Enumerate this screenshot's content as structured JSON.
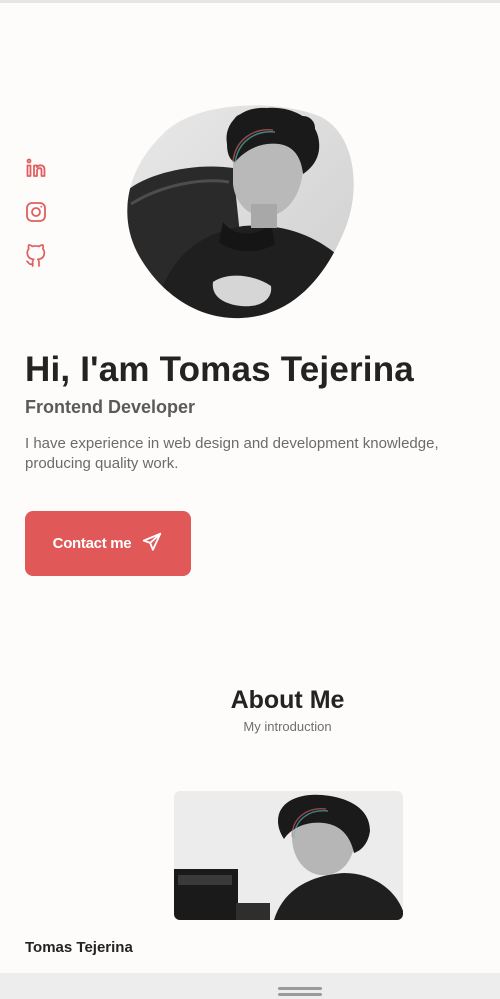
{
  "social": {
    "icons": [
      "linkedin-icon",
      "instagram-icon",
      "github-icon"
    ]
  },
  "hero": {
    "title": "Hi, I'am Tomas Tejerina",
    "subtitle": "Frontend Developer",
    "description": "I have experience in web design and development knowledge, producing quality work.",
    "button_label": "Contact me",
    "button_icon": "send-icon"
  },
  "about": {
    "title": "About Me",
    "subtitle": "My introduction",
    "name": "Tomas Tejerina"
  },
  "colors": {
    "accent": "#e05858",
    "background": "#fdfcfa",
    "text": "#232323"
  }
}
